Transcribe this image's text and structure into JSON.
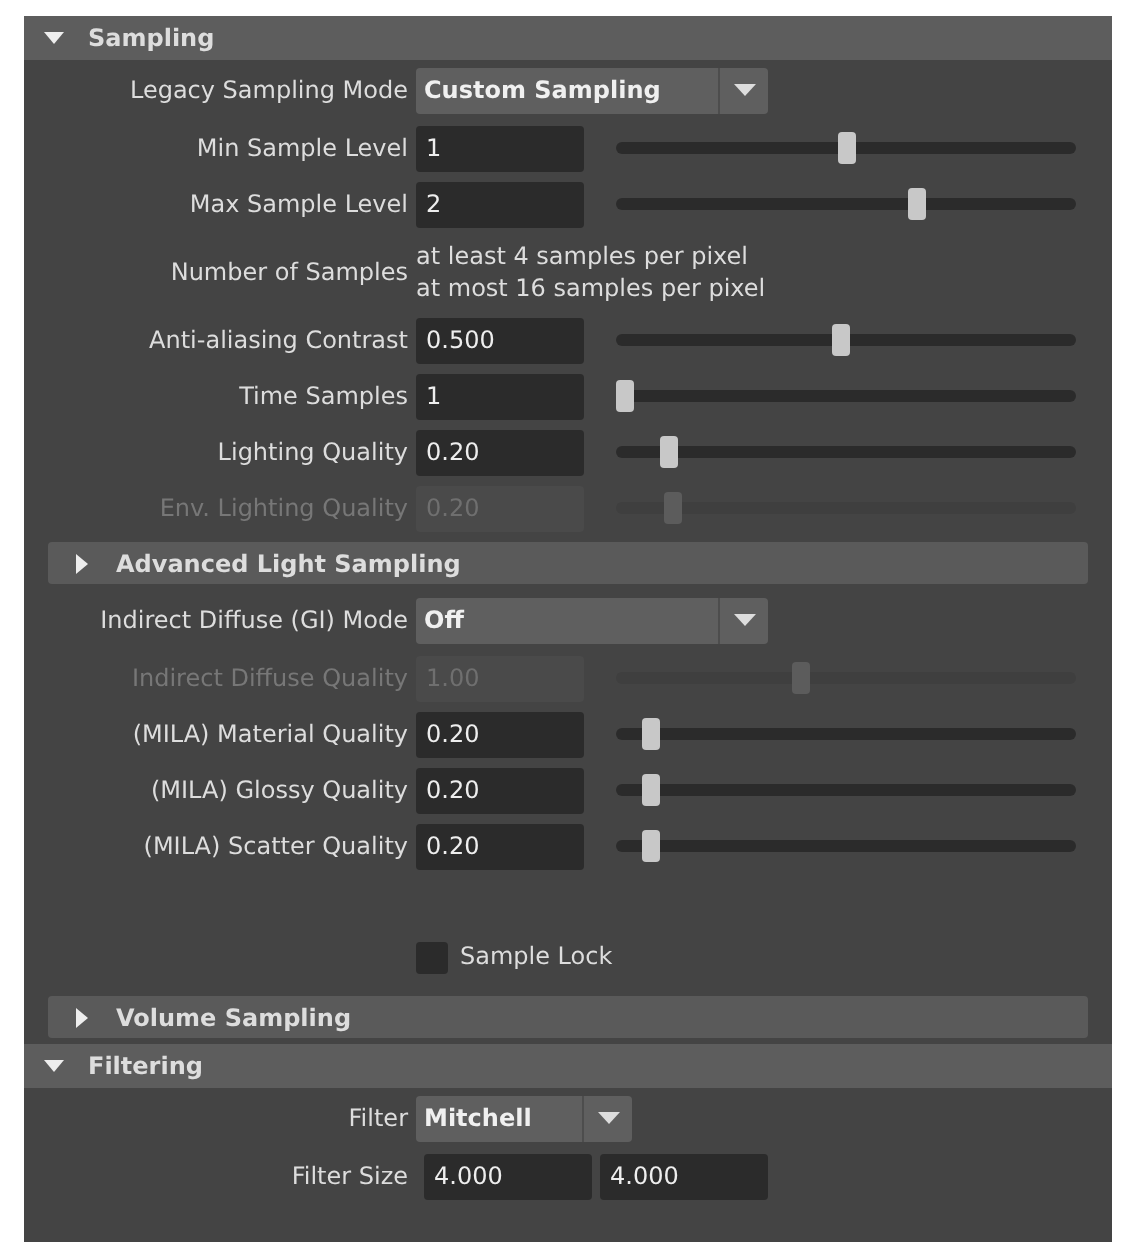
{
  "sections": [
    {
      "title": "Sampling",
      "expanded": true,
      "rows": [
        {
          "kind": "dropdown",
          "label": "Legacy Sampling Mode",
          "value": "Custom Sampling"
        },
        {
          "kind": "slider",
          "label": "Min Sample Level",
          "value": "1",
          "level": 0.5,
          "disabled": false
        },
        {
          "kind": "slider",
          "label": "Max Sample Level",
          "value": "2",
          "level": 0.66,
          "disabled": false
        },
        {
          "kind": "info",
          "label": "Number of Samples",
          "lines": [
            "at least 4 samples per pixel",
            "at most 16 samples per pixel"
          ]
        },
        {
          "kind": "slider",
          "label": "Anti-aliasing Contrast",
          "value": "0.500",
          "level": 0.49,
          "disabled": false
        },
        {
          "kind": "slider",
          "label": "Time Samples",
          "value": "1",
          "level": 0.0,
          "disabled": false
        },
        {
          "kind": "slider",
          "label": "Lighting Quality",
          "value": "0.20",
          "level": 0.1,
          "disabled": false
        },
        {
          "kind": "slider",
          "label": "Env. Lighting Quality",
          "value": "0.20",
          "level": 0.11,
          "disabled": true
        },
        {
          "kind": "subsection",
          "title": "Advanced Light Sampling",
          "expanded": false
        },
        {
          "kind": "dropdown",
          "label": "Indirect Diffuse (GI) Mode",
          "value": "Off"
        },
        {
          "kind": "slider",
          "label": "Indirect Diffuse Quality",
          "value": "1.00",
          "level": 0.4,
          "disabled": true
        },
        {
          "kind": "slider",
          "label": "(MILA) Material Quality",
          "value": "0.20",
          "level": 0.06,
          "disabled": false
        },
        {
          "kind": "slider",
          "label": "(MILA) Glossy Quality",
          "value": "0.20",
          "level": 0.06,
          "disabled": false
        },
        {
          "kind": "slider",
          "label": "(MILA) Scatter Quality",
          "value": "0.20",
          "level": 0.06,
          "disabled": false
        },
        {
          "kind": "checkbox",
          "label": "Sample Lock",
          "checked": false
        },
        {
          "kind": "subsection",
          "title": "Volume Sampling",
          "expanded": false
        }
      ]
    },
    {
      "title": "Filtering",
      "expanded": true,
      "rows": [
        {
          "kind": "dropdown",
          "label": "Filter",
          "value": "Mitchell"
        },
        {
          "kind": "pair",
          "label": "Filter Size",
          "values": [
            "4.000",
            "4.000"
          ]
        }
      ]
    }
  ]
}
